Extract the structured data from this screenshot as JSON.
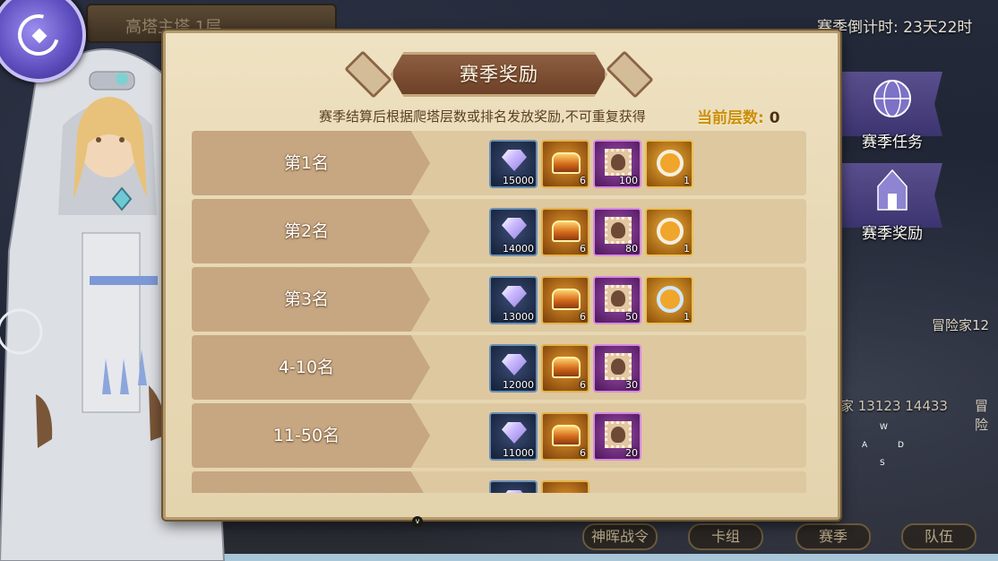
{
  "background": {
    "floor_title": "高塔主塔 1层",
    "countdown": "赛季倒计时: 23天22时",
    "adventurer_label": "冒险家12",
    "score_text": "家 13123 14433",
    "score_tail": "冒险",
    "keys": [
      "W",
      "A",
      "D",
      "S"
    ],
    "side_buttons": {
      "season_task": "赛季任务",
      "season_reward": "赛季奖励"
    },
    "bottom_buttons": [
      "神晖战令",
      "卡组",
      "赛季",
      "队伍"
    ]
  },
  "panel": {
    "title": "赛季奖励",
    "description": "赛季结算后根据爬塔层数或排名发放奖励,不可重复获得",
    "floor_label": "当前层数:",
    "floor_value": "0",
    "scroll_hint": "v",
    "rows": [
      {
        "label": "第1名",
        "items": [
          {
            "type": "gem",
            "qty": "15000"
          },
          {
            "type": "chest",
            "qty": "6"
          },
          {
            "type": "stamp",
            "qty": "100"
          },
          {
            "type": "ring",
            "qty": "1"
          }
        ]
      },
      {
        "label": "第2名",
        "items": [
          {
            "type": "gem",
            "qty": "14000"
          },
          {
            "type": "chest",
            "qty": "6"
          },
          {
            "type": "stamp",
            "qty": "80"
          },
          {
            "type": "ring",
            "qty": "1"
          }
        ]
      },
      {
        "label": "第3名",
        "items": [
          {
            "type": "gem",
            "qty": "13000"
          },
          {
            "type": "chest",
            "qty": "6"
          },
          {
            "type": "stamp",
            "qty": "50"
          },
          {
            "type": "ring-blue",
            "qty": "1"
          }
        ]
      },
      {
        "label": "4-10名",
        "items": [
          {
            "type": "gem",
            "qty": "12000"
          },
          {
            "type": "chest",
            "qty": "6"
          },
          {
            "type": "stamp",
            "qty": "30"
          }
        ]
      },
      {
        "label": "11-50名",
        "items": [
          {
            "type": "gem",
            "qty": "11000"
          },
          {
            "type": "chest",
            "qty": "6"
          },
          {
            "type": "stamp",
            "qty": "20"
          }
        ]
      },
      {
        "label": "",
        "items": [
          {
            "type": "gem",
            "qty": ""
          },
          {
            "type": "chest",
            "qty": ""
          }
        ]
      }
    ]
  },
  "colors": {
    "panel_bg": "#e8d9b6",
    "row_bg": "#ddc8a0",
    "label_bg": "#c6a782",
    "floor_accent": "#c98f0c",
    "title_plate": "#7a4d33"
  }
}
